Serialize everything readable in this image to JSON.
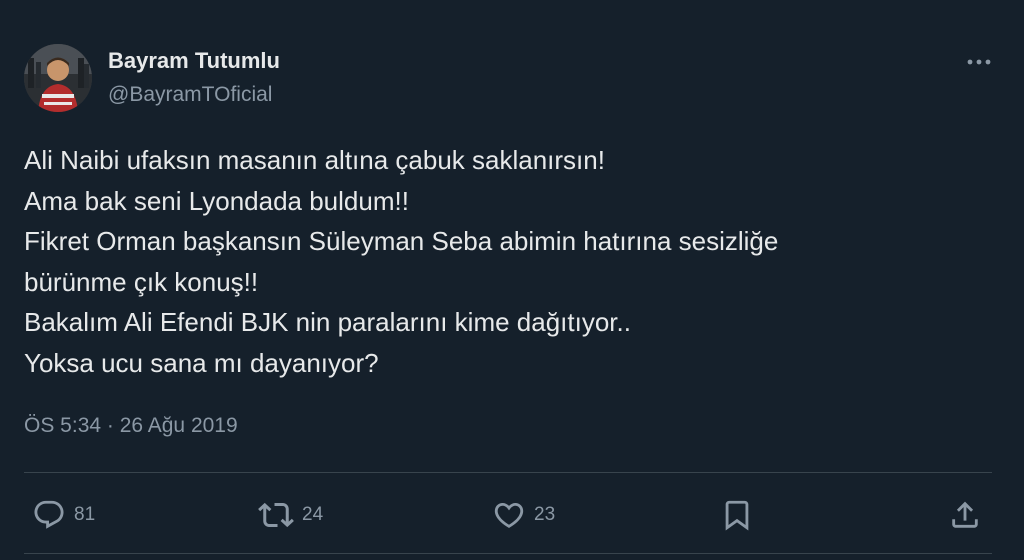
{
  "author": {
    "name": "Bayram Tutumlu",
    "handle": "@BayramTOficial"
  },
  "tweet": {
    "lines": [
      "Ali Naibi ufaksın masanın altına çabuk saklanırsın!",
      "Ama bak seni Lyondada buldum!!",
      "Fikret Orman başkansın Süleyman Seba abimin hatırına sesizliğe",
      "bürünme çık konuş!!",
      "Bakalım Ali Efendi BJK nin paralarını kime dağıtıyor..",
      "Yoksa ucu sana mı dayanıyor?"
    ],
    "timestamp": "ÖS 5:34 · 26 Ağu 2019"
  },
  "actions": {
    "reply": {
      "icon": "reply-icon",
      "count": "81"
    },
    "retweet": {
      "icon": "retweet-icon",
      "count": "24"
    },
    "like": {
      "icon": "heart-icon",
      "count": "23"
    },
    "bookmark": {
      "icon": "bookmark-icon"
    },
    "share": {
      "icon": "share-icon"
    }
  },
  "colors": {
    "background": "#15202b",
    "text": "#e7e9ea",
    "secondary_text": "#8b98a5",
    "divider": "#38444d"
  }
}
